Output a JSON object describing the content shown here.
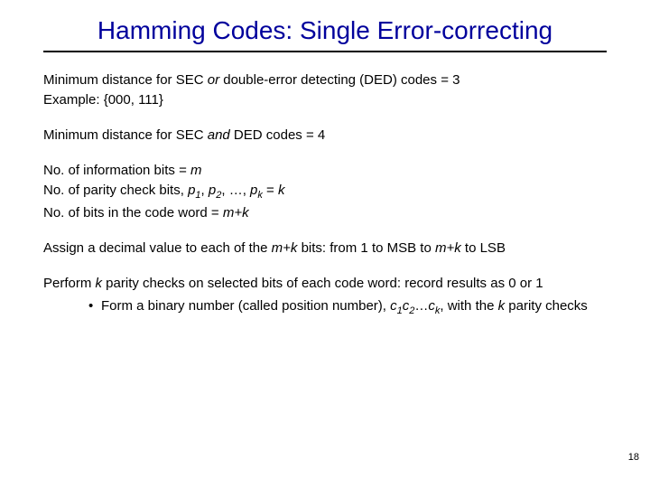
{
  "title": "Hamming Codes: Single Error-correcting",
  "block1": {
    "line1_pre": "Minimum distance for SEC ",
    "line1_or": "or",
    "line1_post": " double-error detecting (DED) codes = 3",
    "line2": "Example: {000, 111}"
  },
  "block2": {
    "line1_pre": "Minimum distance for SEC ",
    "line1_and": "and",
    "line1_post": " DED codes = 4"
  },
  "block3": {
    "l1_pre": "No. of information bits = ",
    "l1_m": "m",
    "l2_pre": "No. of parity check bits, ",
    "l2_p": "p",
    "l2_s1": "1",
    "l2_c1": ", ",
    "l2_s2": "2",
    "l2_c2": ", …, ",
    "l2_sk": "k",
    "l2_post": " = ",
    "l2_k": "k",
    "l3_pre": "No. of bits in the code word = ",
    "l3_mk": "m+k"
  },
  "block4": {
    "l1_pre": "Assign a decimal value to each of the ",
    "l1_mk": "m+k",
    "l1_mid": " bits: from 1 to MSB to ",
    "l1_mk2": "m+k",
    "l1_post": " to LSB"
  },
  "block5": {
    "l1_pre": "Perform ",
    "l1_k": "k",
    "l1_post": " parity checks on selected bits of each code word: record results as 0 or 1",
    "bullet_dot": "•",
    "b_pre": "Form a binary number (called position number), ",
    "b_c": "c",
    "b_s1": "1",
    "b_s2": "2",
    "b_mid": "…",
    "b_sk": "k",
    "b_post": ", with the ",
    "b_k": "k",
    "b_tail": " parity checks"
  },
  "page_number": "18"
}
